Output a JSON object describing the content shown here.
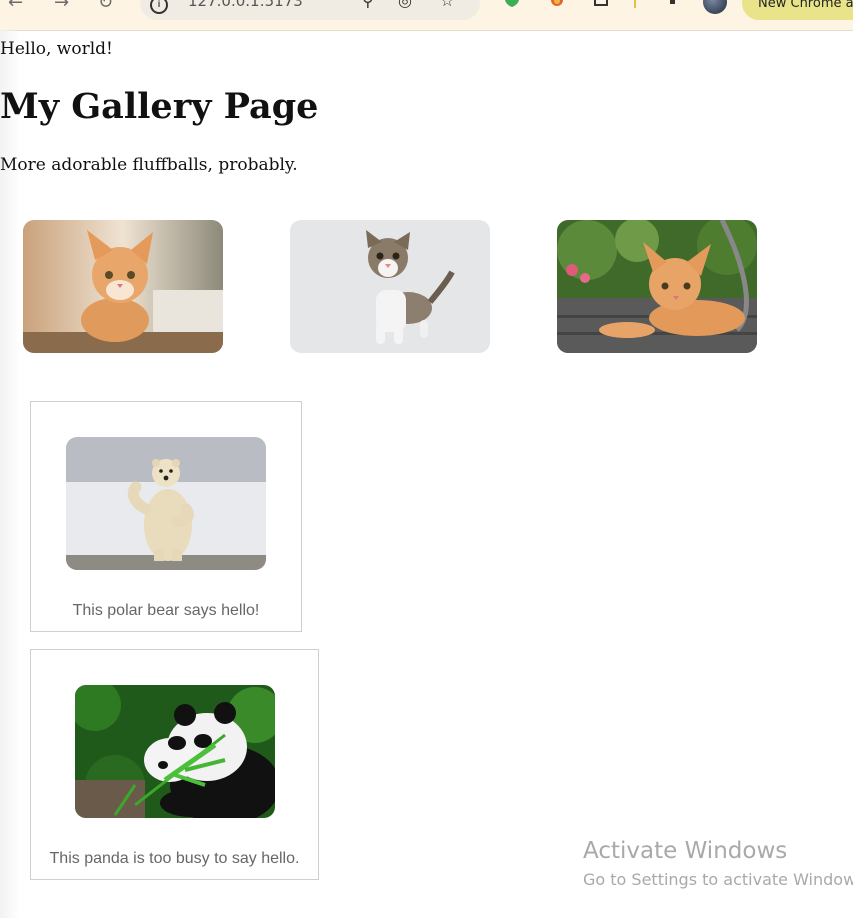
{
  "browser": {
    "url": "127.0.0.1:5173",
    "chrome_button_label": "New Chrome a"
  },
  "page": {
    "hello_text": "Hello, world!",
    "title": "My Gallery Page",
    "subtitle": "More adorable fluffballs, probably."
  },
  "gallery": {
    "images": [
      {
        "name": "orange kitten on cushion"
      },
      {
        "name": "tabby kitten on white background"
      },
      {
        "name": "ginger kitten lying on deck"
      }
    ]
  },
  "cards": [
    {
      "image": "polar bear waving",
      "caption": "This polar bear says hello!"
    },
    {
      "image": "panda eating bamboo",
      "caption": "This panda is too busy to say hello."
    }
  ],
  "watermark": {
    "line1": "Activate Windows",
    "line2": "Go to Settings to activate Windows."
  }
}
